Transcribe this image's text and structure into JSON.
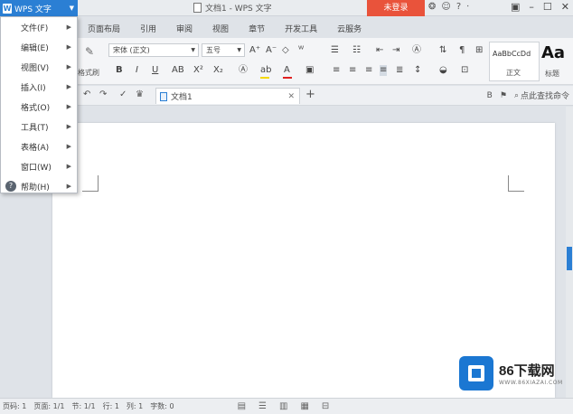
{
  "app": {
    "menu_label": "WPS 文字",
    "window_title": "文档1 - WPS 文字",
    "login_label": "未登录"
  },
  "tabs": [
    "页面布局",
    "引用",
    "审阅",
    "视图",
    "章节",
    "开发工具",
    "云服务"
  ],
  "ribbon": {
    "font_name": "宋体 (正文)",
    "font_size": "五号",
    "format_brush_label": "格式刷",
    "style_normal_sample": "AaBbCcDd",
    "style_normal_name": "正文",
    "style_heading_sample": "Aa",
    "style_heading_name": "标题"
  },
  "qbar": {
    "doc_tab_label": "文档1",
    "search_cmd_label": "点此查找命令"
  },
  "menu": {
    "items": [
      {
        "label": "文件(F)"
      },
      {
        "label": "编辑(E)"
      },
      {
        "label": "视图(V)"
      },
      {
        "label": "插入(I)"
      },
      {
        "label": "格式(O)"
      },
      {
        "label": "工具(T)"
      },
      {
        "label": "表格(A)"
      },
      {
        "label": "窗口(W)"
      },
      {
        "label": "帮助(H)"
      }
    ]
  },
  "status": {
    "page_no": "页码: 1",
    "pages": "页面: 1/1",
    "section": "节: 1/1",
    "row": "行: 1",
    "col": "列: 1",
    "word_count": "字数: 0"
  },
  "watermark": {
    "brand": "86下载网",
    "domain": "WWW.86XIAZAI.COM"
  }
}
